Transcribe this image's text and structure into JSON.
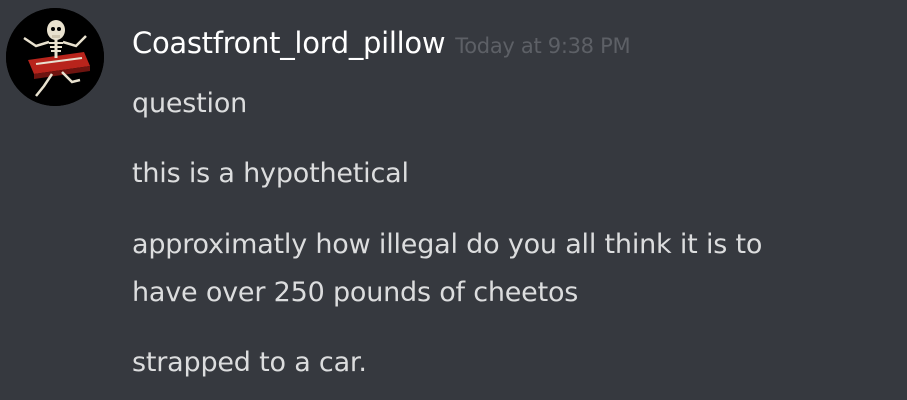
{
  "message": {
    "author": "Coastfront_lord_pillow",
    "timestamp": "Today at 9:38 PM",
    "avatar_icon": "skeleton-on-bed-avatar",
    "lines": [
      "question",
      "this is a hypothetical",
      "approximatly how illegal do you all think it is to",
      "have over 250 pounds of cheetos",
      "strapped to a car."
    ]
  },
  "colors": {
    "background": "#36393f",
    "username": "#ffffff",
    "timestamp": "#72767d",
    "text": "#dcddde"
  }
}
